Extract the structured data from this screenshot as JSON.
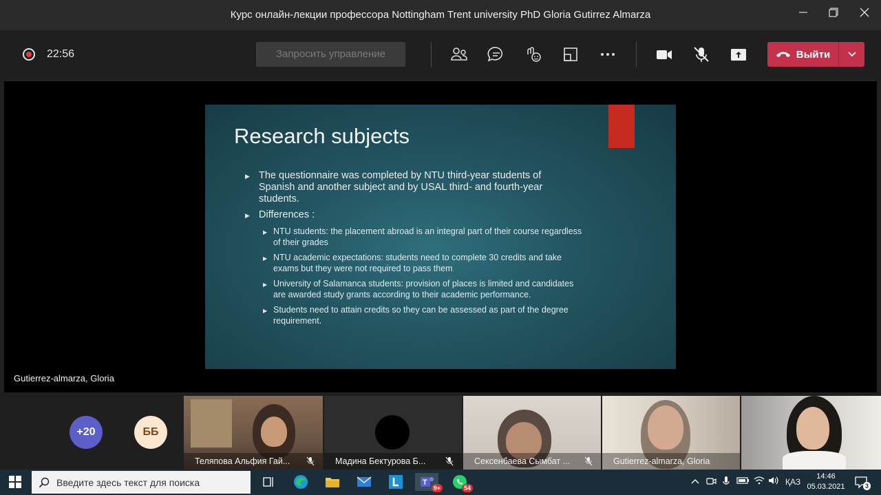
{
  "window": {
    "title": "Курс онлайн-лекции профессора Nottingham Trent university PhD Gloria Gutirrez Almarza"
  },
  "meeting": {
    "timer": "22:56",
    "request_control_label": "Запросить управление",
    "leave_label": "Выйти",
    "icons": [
      "participants-icon",
      "chat-icon",
      "reactions-icon",
      "rooms-icon",
      "more-icon",
      "camera-icon",
      "mic-muted-icon",
      "share-icon"
    ]
  },
  "slide": {
    "title": "Research subjects",
    "bullets": [
      "The questionnaire was completed by NTU third-year students of Spanish and another subject and by USAL third- and fourth-year students.",
      "Differences :"
    ],
    "sub_bullets": [
      "NTU students: the placement abroad is an integral part of their course regardless of their grades",
      "NTU academic expectations: students need to complete 30 credits and take exams but they were not required to pass them",
      "University of Salamanca students: provision of places is limited and candidates are awarded study grants according to their academic performance.",
      "Students need to attain credits so they can be assessed as part of the degree requirement."
    ],
    "presenter": "Gutierrez-almarza, Gloria"
  },
  "participants": {
    "overflow_count": "+20",
    "initials": "ББ",
    "tiles": [
      {
        "name": "Теляпова Альфия Гай..."
      },
      {
        "name": "Мадина Бектурова Б..."
      },
      {
        "name": "Сексенбаева Сымбат ..."
      },
      {
        "name": "Gutierrez-almarza, Gloria"
      },
      {
        "name": ""
      }
    ]
  },
  "taskbar": {
    "search_placeholder": "Введите здесь текст для поиска",
    "teams_badge": "9+",
    "whatsapp_badge": "54",
    "lang": "ҚАЗ",
    "time": "14:46",
    "date": "05.03.2021",
    "notifications": "3"
  },
  "colors": {
    "leave": "#c4314b",
    "background": "#1f1f1f",
    "slide_accent": "#c72a20",
    "taskbar": "#1c2d3a"
  }
}
